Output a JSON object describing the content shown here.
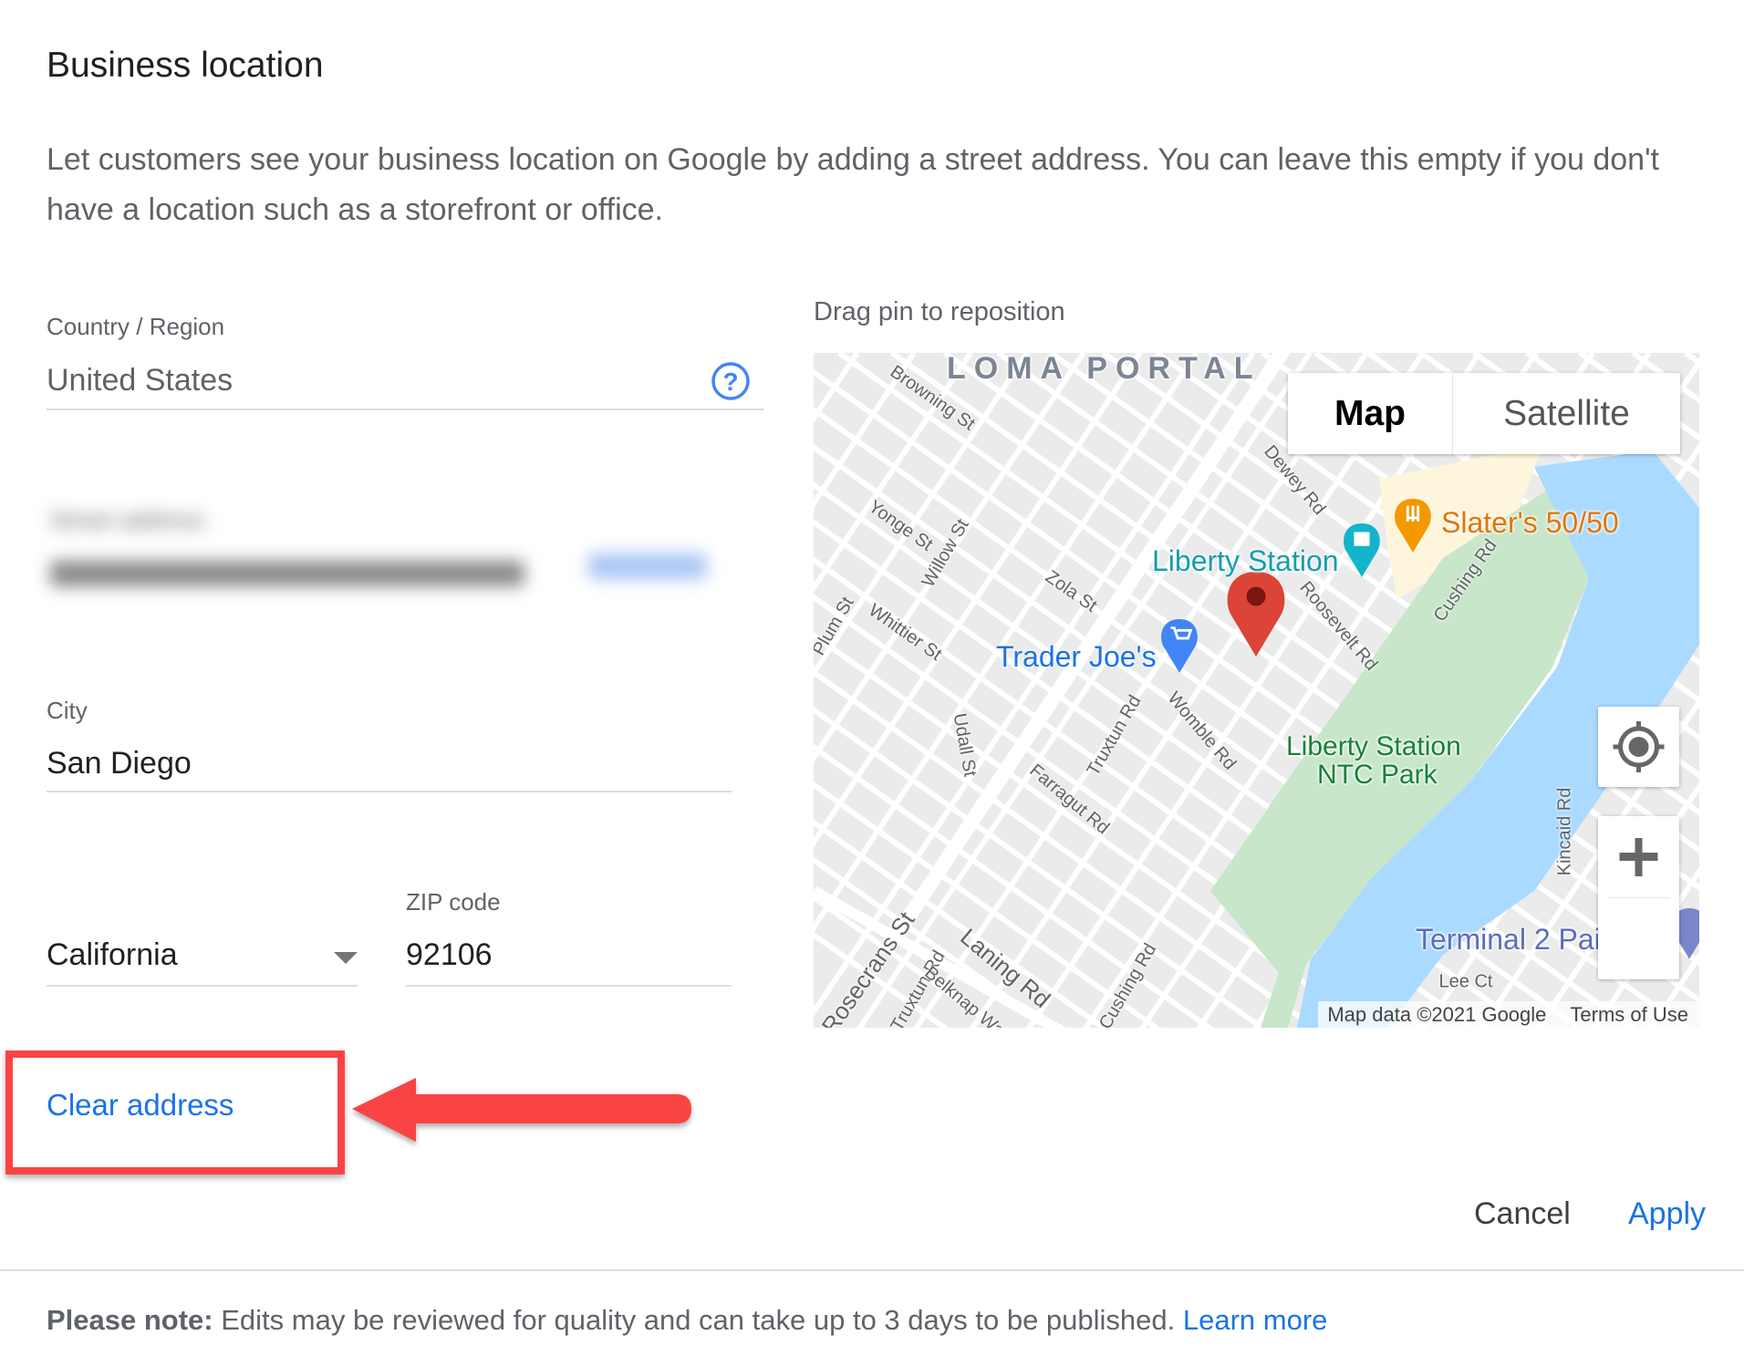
{
  "title": "Business location",
  "description": "Let customers see your business location on Google by adding a street address. You can leave this empty if you don't have a location such as a storefront or office.",
  "form": {
    "country_label": "Country / Region",
    "country_value": "United States",
    "help_icon": "help-circle-icon",
    "street_label": "Street address",
    "city_label": "City",
    "city_value": "San Diego",
    "state_value": "California",
    "zip_label": "ZIP code",
    "zip_value": "92106"
  },
  "clear_address": "Clear address",
  "map": {
    "hint": "Drag pin to reposition",
    "type_map": "Map",
    "type_satellite": "Satellite",
    "neighborhood": "LOMA PORTAL",
    "places": {
      "slaters": "Slater's 50/50",
      "liberty_station": "Liberty Station",
      "trader_joes": "Trader Joe's",
      "park_line1": "Liberty Station",
      "park_line2": "NTC Park",
      "terminal": "Terminal 2 Pai"
    },
    "streets": [
      "Browning St",
      "Dewey Rd",
      "Yonge St",
      "Willow St",
      "Zola St",
      "Plum St",
      "Whittier St",
      "Roosevelt Rd",
      "Cushing Rd",
      "Truxtun Rd",
      "Womble Rd",
      "Udall St",
      "Farragut Rd",
      "Kincaid Rd",
      "Rosecrans St",
      "Laning Rd",
      "Truxtun Rd",
      "Belknap Wa",
      "Cushing Rd",
      "Lee Ct"
    ],
    "attribution": "Map data ©2021 Google",
    "terms": "Terms of Use",
    "colors": {
      "water": "#aadaff",
      "park": "#c8e6c9",
      "commercial": "#fdf6dc",
      "pin": "#ea4335"
    }
  },
  "actions": {
    "cancel": "Cancel",
    "apply": "Apply"
  },
  "note": {
    "bold": "Please note:",
    "text": " Edits may be reviewed for quality and can take up to 3 days to be published. ",
    "link": "Learn more"
  },
  "colors": {
    "accent": "#1a73e8",
    "annotation": "#fa4444"
  }
}
